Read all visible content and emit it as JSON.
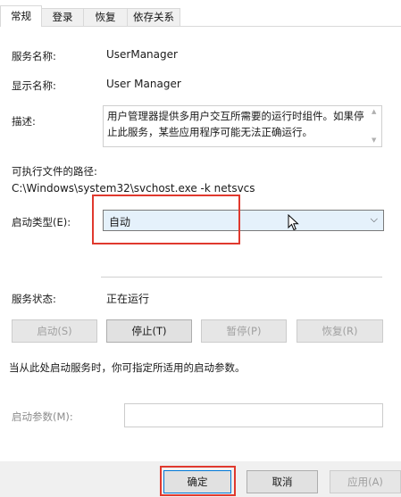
{
  "tabs": [
    {
      "label": "常规",
      "active": true
    },
    {
      "label": "登录",
      "active": false
    },
    {
      "label": "恢复",
      "active": false
    },
    {
      "label": "依存关系",
      "active": false
    }
  ],
  "service_name": {
    "label": "服务名称:",
    "value": "UserManager"
  },
  "display_name": {
    "label": "显示名称:",
    "value": "User Manager"
  },
  "description": {
    "label": "描述:",
    "value": "用户管理器提供多用户交互所需要的运行时组件。如果停止此服务，某些应用程序可能无法正确运行。"
  },
  "exe_path": {
    "label": "可执行文件的路径:",
    "value": "C:\\Windows\\system32\\svchost.exe -k netsvcs"
  },
  "startup_type": {
    "label": "启动类型(E):",
    "value": "自动"
  },
  "service_status": {
    "label": "服务状态:",
    "value": "正在运行"
  },
  "control_buttons": {
    "start": {
      "label": "启动(S)",
      "enabled": false
    },
    "stop": {
      "label": "停止(T)",
      "enabled": true
    },
    "pause": {
      "label": "暂停(P)",
      "enabled": false
    },
    "resume": {
      "label": "恢复(R)",
      "enabled": false
    }
  },
  "hint": "当从此处启动服务时，你可指定所适用的启动参数。",
  "start_params": {
    "label": "启动参数(M):",
    "value": ""
  },
  "dialog_buttons": {
    "ok": {
      "label": "确定",
      "enabled": true
    },
    "cancel": {
      "label": "取消",
      "enabled": true
    },
    "apply": {
      "label": "应用(A)",
      "enabled": false
    }
  },
  "colors": {
    "highlight_box": "#e0392e",
    "combo_background": "#e5f1fb",
    "default_button_border": "#0078d7"
  }
}
